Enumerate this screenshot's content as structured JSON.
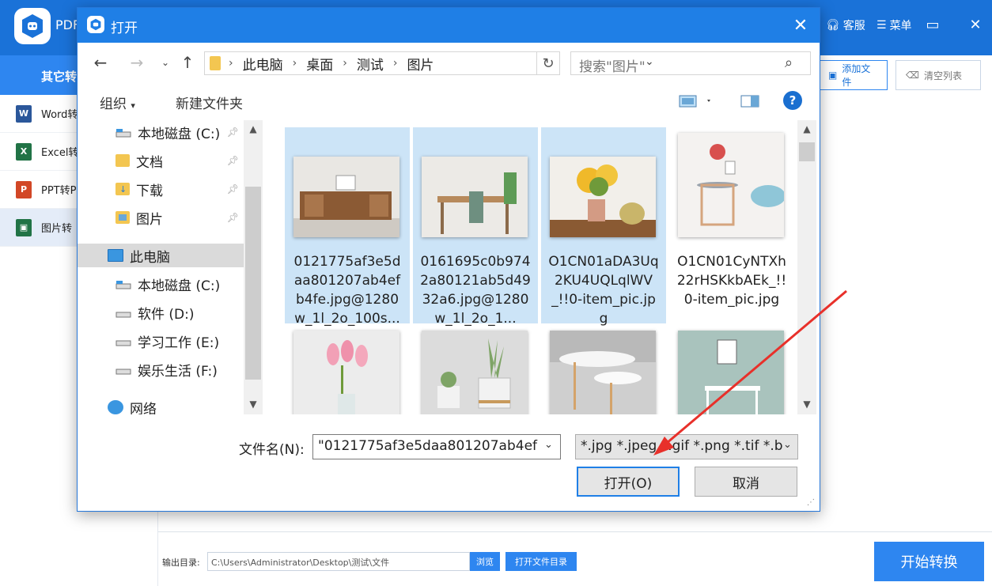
{
  "app": {
    "title": "PDF",
    "service_label": "客服",
    "menu_label": "菜单",
    "sidebar_header": "其它转",
    "sidebar_items": [
      {
        "label": "Word转",
        "icon": "word-icon"
      },
      {
        "label": "Excel转",
        "icon": "excel-icon"
      },
      {
        "label": "PPT转P",
        "icon": "ppt-icon"
      },
      {
        "label": "图片转",
        "icon": "image-icon"
      }
    ],
    "add_file_label": "添加文件",
    "clear_list_label": "清空列表",
    "output_label": "输出目录:",
    "output_path": "C:\\Users\\Administrator\\Desktop\\测试\\文件",
    "browse_label": "浏览",
    "open_dir_label": "打开文件目录",
    "start_label": "开始转换",
    "colors": {
      "brand": "#1a72d8",
      "accent": "#2e86f0"
    }
  },
  "dialog": {
    "title": "打开",
    "address": [
      "此电脑",
      "桌面",
      "测试",
      "图片"
    ],
    "search_placeholder": "搜索\"图片\"",
    "organize_label": "组织",
    "new_folder_label": "新建文件夹",
    "tree": [
      {
        "label": "本地磁盘 (C:)",
        "icon": "drive-icon",
        "pinned": true
      },
      {
        "label": "文档",
        "icon": "folder-icon",
        "pinned": true
      },
      {
        "label": "下载",
        "icon": "download-folder-icon",
        "pinned": true
      },
      {
        "label": "图片",
        "icon": "pictures-folder-icon",
        "pinned": true
      },
      {
        "label": "此电脑",
        "icon": "pc-icon",
        "pinned": false
      },
      {
        "label": "本地磁盘 (C:)",
        "icon": "drive-icon",
        "pinned": false
      },
      {
        "label": "软件 (D:)",
        "icon": "drive-icon",
        "pinned": false
      },
      {
        "label": "学习工作 (E:)",
        "icon": "drive-icon",
        "pinned": false
      },
      {
        "label": "娱乐生活 (F:)",
        "icon": "drive-icon",
        "pinned": false
      },
      {
        "label": "网络",
        "icon": "network-icon",
        "pinned": false
      }
    ],
    "files": [
      {
        "name": "0121775af3e5daa801207ab4efb4fe.jpg@1280w_1l_2o_100s...",
        "selected": true
      },
      {
        "name": "0161695c0b9742a80121ab5d4932a6.jpg@1280w_1l_2o_1...",
        "selected": true
      },
      {
        "name": "O1CN01aDA3Uq2KU4UQLqlWV_!!0-item_pic.jpg",
        "selected": true
      },
      {
        "name": "O1CN01CyNTXh22rHSKkbAEk_!!0-item_pic.jpg",
        "selected": false
      },
      {
        "name": "",
        "selected": false
      },
      {
        "name": "",
        "selected": false
      },
      {
        "name": "",
        "selected": false
      },
      {
        "name": "",
        "selected": false
      }
    ],
    "filename_label": "文件名(N):",
    "filename_value": "\"0121775af3e5daa801207ab4ef",
    "filetype_value": "*.jpg *.jpeg *.gif *.png *.tif *.b",
    "open_label": "打开(O)",
    "cancel_label": "取消"
  }
}
